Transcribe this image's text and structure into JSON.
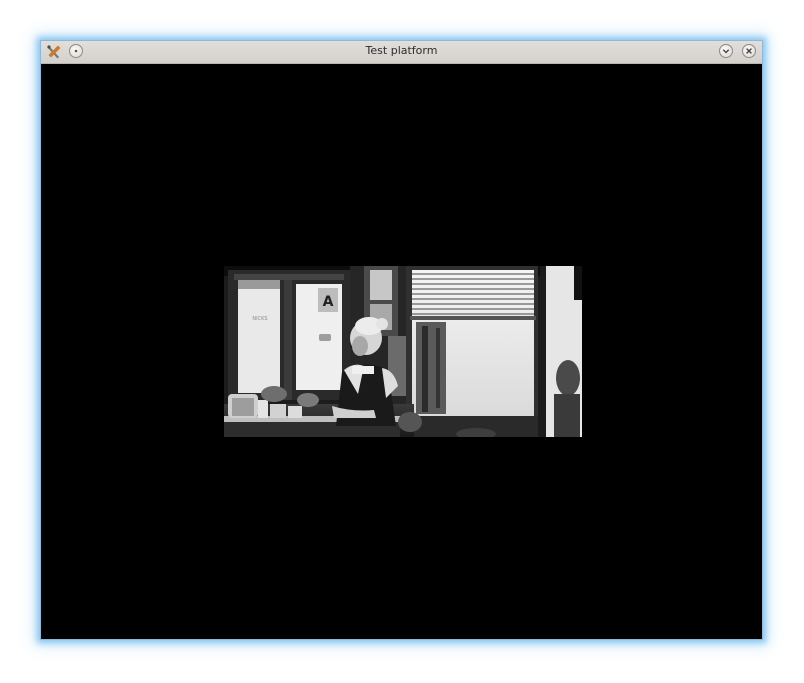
{
  "window": {
    "title": "Test platform"
  },
  "titlebar": {
    "app_icon": "tools-icon",
    "menu_button_icon": "window-menu-icon",
    "minimize_button_icon": "chevron-down-icon",
    "close_button_icon": "close-icon"
  },
  "video": {
    "sign_letter": "A",
    "door_lettering": "NICKS"
  },
  "colors": {
    "titlebar": "#d8d5d0",
    "content_background": "#000000",
    "window_glow": "#6eb9f0"
  }
}
